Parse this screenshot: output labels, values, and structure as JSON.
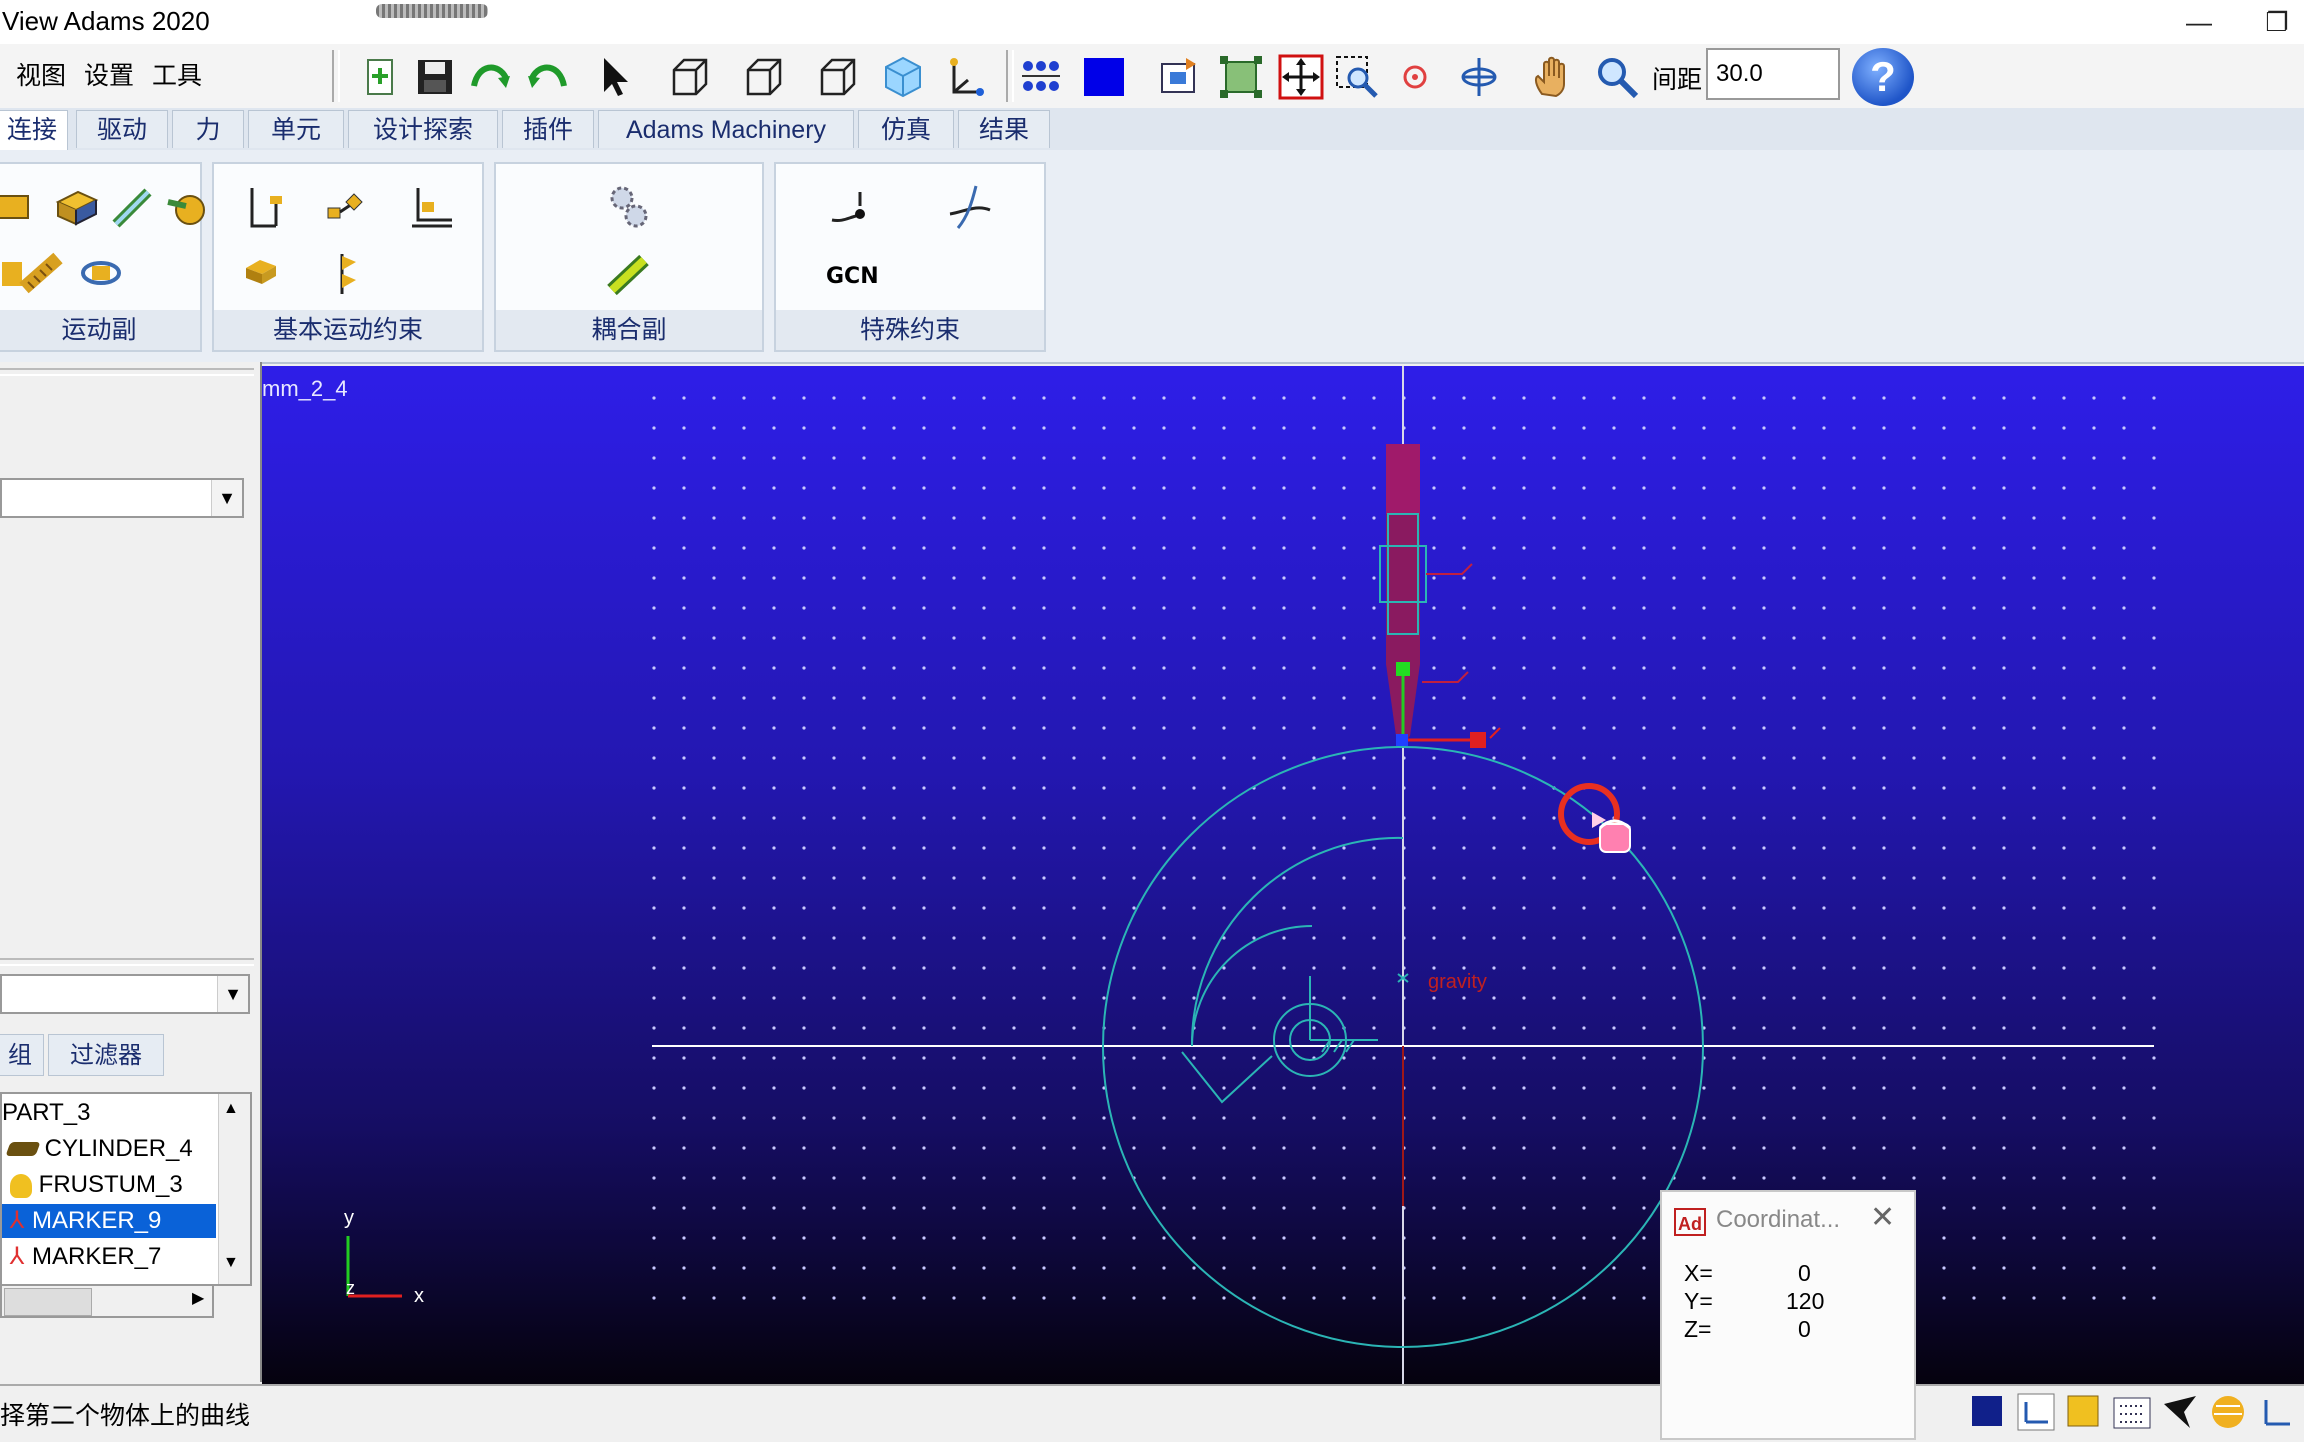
{
  "window": {
    "title": "View Adams 2020"
  },
  "menu": [
    "视图",
    "设置",
    "工具"
  ],
  "toolbar": {
    "spacing_label": "间距",
    "spacing_value": "30.0"
  },
  "tabs": [
    {
      "label": "连接",
      "active": true
    },
    {
      "label": "驱动"
    },
    {
      "label": "力"
    },
    {
      "label": "单元"
    },
    {
      "label": "设计探索"
    },
    {
      "label": "插件"
    },
    {
      "label": "Adams Machinery"
    },
    {
      "label": "仿真"
    },
    {
      "label": "结果"
    }
  ],
  "ribbon": {
    "groups": [
      {
        "label": "运动副"
      },
      {
        "label": "基本运动约束"
      },
      {
        "label": "耦合副"
      },
      {
        "label": "特殊约束",
        "gcon_text": "GCN"
      }
    ]
  },
  "browser": {
    "tabs": [
      "组",
      "过滤器"
    ],
    "tree": [
      "PART_3",
      "CYLINDER_4",
      "FRUSTUM_3",
      "MARKER_9",
      "MARKER_7"
    ],
    "selected": "MARKER_9"
  },
  "viewport": {
    "model_name": "mm_2_4",
    "gravity_label": "gravity",
    "triad": {
      "y": "y",
      "x": "x",
      "z": "z"
    }
  },
  "coordinates": {
    "title": "Coordinat...",
    "app_badge": "Ad",
    "x_label": "X=",
    "x": "0",
    "y_label": "Y=",
    "y": "120",
    "z_label": "Z=",
    "z": "0"
  },
  "status": {
    "message": "择第二个物体上的曲线"
  },
  "colors": {
    "accent": "#0a62d8",
    "viewport_top": "#2e1ee8",
    "cyan_geometry": "#2bb5b5",
    "marker_red": "#e02020"
  }
}
